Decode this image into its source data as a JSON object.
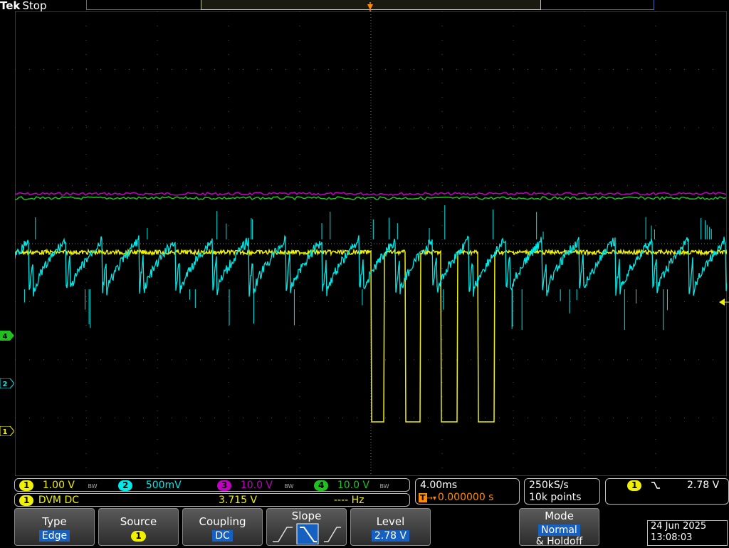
{
  "brand": {
    "name": "Tek",
    "status": "Stop"
  },
  "trigger_marker": "T",
  "channel_markers": [
    "4",
    "2",
    "1"
  ],
  "channels": [
    {
      "num": "1",
      "scale": "1.00 V",
      "color": "#f0f000",
      "bw": "BW"
    },
    {
      "num": "2",
      "scale": "500mV",
      "color": "#00e8e8",
      "bw": ""
    },
    {
      "num": "3",
      "scale": "10.0 V",
      "color": "#c000c0",
      "bw": "BW"
    },
    {
      "num": "4",
      "scale": "10.0 V",
      "color": "#20c020",
      "bw": "BW"
    }
  ],
  "dvm": {
    "channel": "1",
    "label": "DVM DC",
    "value": "3.715 V",
    "freq": "---- Hz"
  },
  "timebase": {
    "scale": "4.00ms",
    "trigger_pos_prefix": "T",
    "position": "0.000000 s"
  },
  "acquisition": {
    "rate": "250kS/s",
    "points": "10k points"
  },
  "trigger_readout": {
    "channel": "1",
    "level": "2.78 V"
  },
  "menu": {
    "type": {
      "title": "Type",
      "value": "Edge"
    },
    "source": {
      "title": "Source",
      "value": "1"
    },
    "coupling": {
      "title": "Coupling",
      "value": "DC"
    },
    "slope": {
      "title": "Slope"
    },
    "level": {
      "title": "Level",
      "value": "2.78 V"
    },
    "mode": {
      "title": "Mode",
      "value": "Normal",
      "sub": "& Holdoff"
    }
  },
  "datetime": {
    "date": "24 Jun 2025",
    "time": "13:08:03"
  },
  "colors": {
    "ch1": "#f0f000",
    "ch2": "#00e8e8",
    "ch3": "#c000c0",
    "ch4": "#20c020",
    "trigger": "#ff8c00",
    "accent": "#1560c0"
  }
}
